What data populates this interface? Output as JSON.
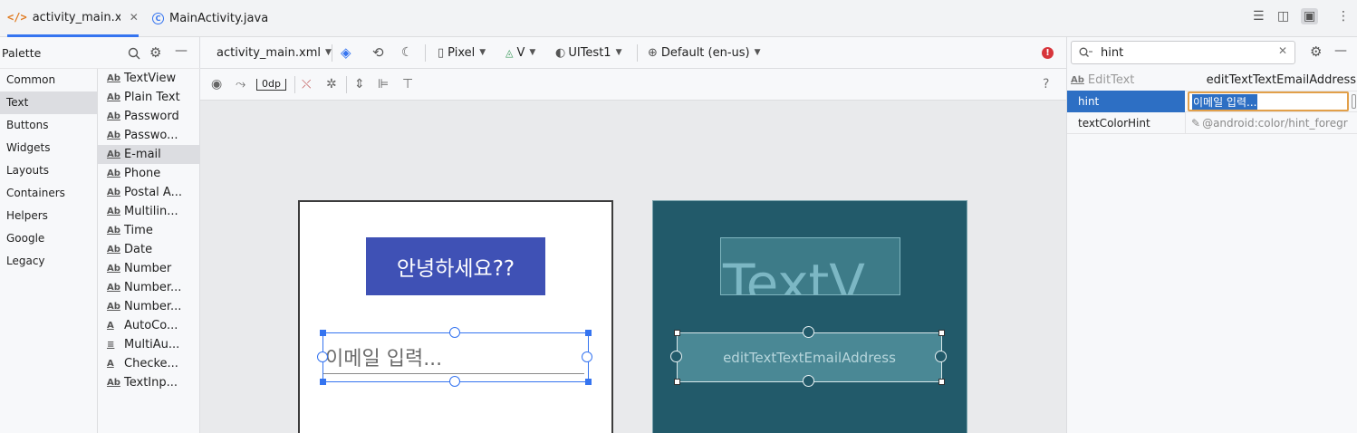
{
  "tabs": [
    {
      "label": "activity_main.xml",
      "icon": "xml-file-icon",
      "active": true
    },
    {
      "label": "MainActivity.java",
      "icon": "java-class-icon",
      "active": false
    }
  ],
  "palette": {
    "title": "Palette",
    "categories": [
      "Common",
      "Text",
      "Buttons",
      "Widgets",
      "Layouts",
      "Containers",
      "Helpers",
      "Google",
      "Legacy"
    ],
    "selected_category": "Text",
    "widgets": [
      {
        "icon": "Ab",
        "label": "TextView"
      },
      {
        "icon": "Ab",
        "label": "Plain Text"
      },
      {
        "icon": "Ab",
        "label": "Password"
      },
      {
        "icon": "Ab",
        "label": "Passwo..."
      },
      {
        "icon": "Ab",
        "label": "E-mail"
      },
      {
        "icon": "Ab",
        "label": "Phone"
      },
      {
        "icon": "Ab",
        "label": "Postal A..."
      },
      {
        "icon": "Ab",
        "label": "Multilin..."
      },
      {
        "icon": "Ab",
        "label": "Time"
      },
      {
        "icon": "Ab",
        "label": "Date"
      },
      {
        "icon": "Ab",
        "label": "Number"
      },
      {
        "icon": "Ab",
        "label": "Number..."
      },
      {
        "icon": "Ab",
        "label": "Number..."
      },
      {
        "icon": "A",
        "label": "AutoCo..."
      },
      {
        "icon": "≡",
        "label": "MultiAu..."
      },
      {
        "icon": "A",
        "label": "Checke..."
      },
      {
        "icon": "Ab",
        "label": "TextInp..."
      }
    ],
    "selected_widget": "E-mail"
  },
  "toolbar": {
    "file": "activity_main.xml",
    "device": "Pixel",
    "api": "V",
    "theme": "UITest1",
    "locale": "Default (en-us)",
    "margin": "0dp",
    "help": "?"
  },
  "design": {
    "greeting": "안녕하세요??",
    "email_hint": "이메일 입력...",
    "blueprint_text": "TextV",
    "blueprint_email": "editTextTextEmailAddress"
  },
  "attributes": {
    "search_value": "hint",
    "component_type": "EditText",
    "component_id": "editTextTextEmailAddress",
    "rows": [
      {
        "name": "hint",
        "value": "이메일 입력...",
        "selected": true
      },
      {
        "name": "textColorHint",
        "value": "@android:color/hint_foregr"
      }
    ]
  },
  "colors": {
    "accent": "#3574f0",
    "greeting_bg": "#3f51b5",
    "blueprint_bg": "#225a6a",
    "error": "#d7353b",
    "selected_row": "#2d6fc4"
  }
}
